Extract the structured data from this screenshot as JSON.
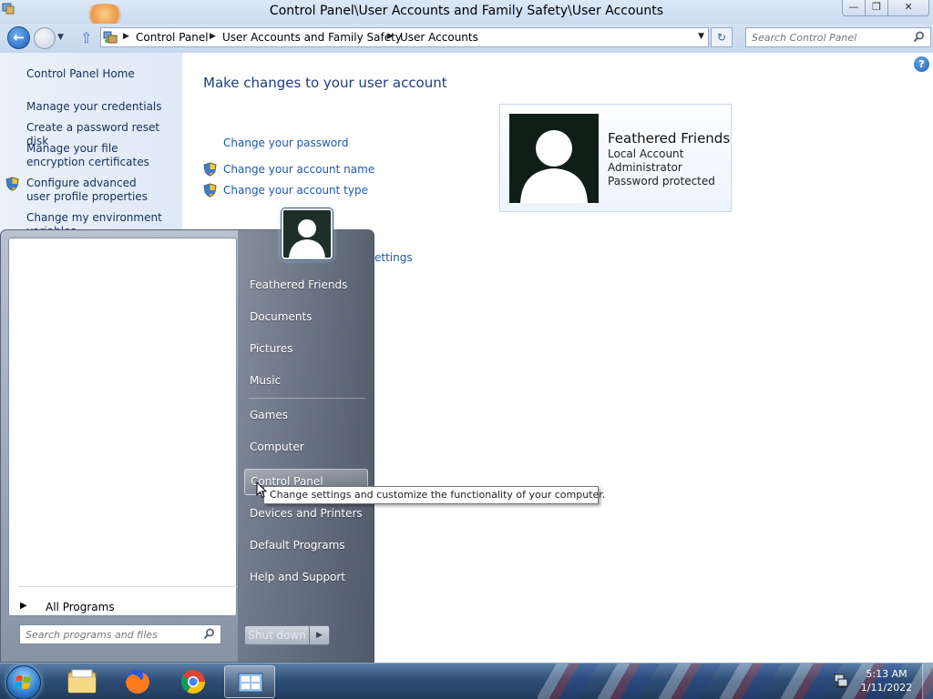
{
  "window": {
    "title": "Control Panel\\User Accounts and Family Safety\\User Accounts",
    "minimize_glyph": "—",
    "maximize_glyph": "❐",
    "close_glyph": "✕"
  },
  "nav": {
    "back_glyph": "←",
    "up_glyph": "⇧",
    "breadcrumbs": [
      "Control Panel",
      "User Accounts and Family Safety",
      "User Accounts"
    ],
    "search_placeholder": "Search Control Panel",
    "refresh_glyph": "↻"
  },
  "left_pane": {
    "home": "Control Panel Home",
    "links": [
      "Manage your credentials",
      "Create a password reset disk",
      "Manage your file encryption certificates",
      "Configure advanced user profile properties",
      "Change my environment variables"
    ]
  },
  "main": {
    "heading": "Make changes to your user account",
    "tasks": [
      "Change your password",
      "Change your account name",
      "Change your account type"
    ],
    "partial_link": "ettings",
    "help_glyph": "?",
    "account": {
      "name": "Feathered Friends",
      "type": "Local Account",
      "role": "Administrator",
      "status": "Password protected"
    }
  },
  "start_menu": {
    "right_items": [
      "Feathered Friends",
      "Documents",
      "Pictures",
      "Music",
      "Games",
      "Computer",
      "Control Panel",
      "Devices and Printers",
      "Default Programs",
      "Help and Support"
    ],
    "highlighted": "Control Panel",
    "all_programs": "All Programs",
    "search_placeholder": "Search programs and files",
    "shutdown": "Shut down"
  },
  "tooltip": "Change settings and customize the functionality of your computer.",
  "taskbar": {
    "time": "5:13 AM",
    "date": "1/11/2022"
  },
  "colors": {
    "link": "#1d57b0",
    "heading": "#1e3e80",
    "taskbar": "#2f4f76"
  }
}
